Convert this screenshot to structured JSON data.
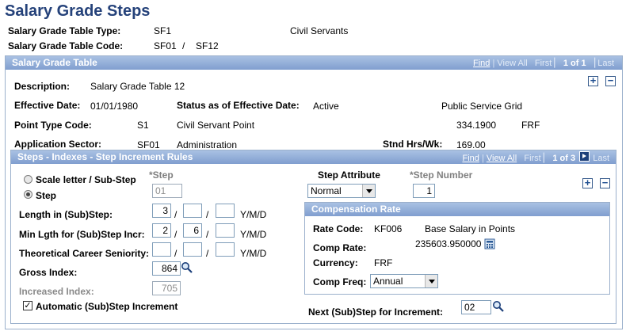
{
  "page_title": "Salary Grade Steps",
  "header": {
    "table_type_label": "Salary Grade Table Type:",
    "table_type_value": "SF1",
    "table_type_desc": "Civil Servants",
    "table_code_label": "Salary Grade Table Code:",
    "table_code_value1": "SF01",
    "table_code_sep": "/",
    "table_code_value2": "SF12"
  },
  "salary_grade_table": {
    "title": "Salary Grade Table",
    "nav": {
      "find": "Find",
      "sep": "|",
      "view_all": "View All",
      "first": "First",
      "count": "1 of 1",
      "last": "Last"
    },
    "description_label": "Description:",
    "description_value": "Salary Grade Table 12",
    "effective_date_label": "Effective Date:",
    "effective_date_value": "01/01/1980",
    "status_label": "Status as of Effective Date:",
    "status_value": "Active",
    "grid_value": "Public Service Grid",
    "point_type_label": "Point Type Code:",
    "point_type_code": "S1",
    "point_type_desc": "Civil Servant Point",
    "point_value": "334.1900",
    "point_currency": "FRF",
    "sector_label": "Application Sector:",
    "sector_code": "SF01",
    "sector_desc": "Administration",
    "std_hours_label": "Stnd Hrs/Wk:",
    "std_hours_value": "169.00",
    "add_symbol": "+",
    "remove_symbol": "−"
  },
  "steps": {
    "title": "Steps - Indexes - Step Increment Rules",
    "nav": {
      "find": "Find",
      "sep": "|",
      "view_all": "View All",
      "first": "First",
      "count": "1 of 3",
      "last": "Last"
    },
    "radio_scale_label": "Scale letter / Sub-Step",
    "radio_step_label": "Step",
    "step_col_label": "*Step",
    "step_value": "01",
    "step_attribute_label": "Step Attribute",
    "step_attribute_value": "Normal",
    "step_number_label": "*Step Number",
    "step_number_value": "1",
    "length_label": "Length in (Sub)Step:",
    "length_values": [
      "3",
      "",
      ""
    ],
    "min_length_label": "Min Lgth for (Sub)Step Incr:",
    "min_length_values": [
      "2",
      "6",
      ""
    ],
    "career_label": "Theoretical Career Seniority:",
    "career_values": [
      "",
      "",
      ""
    ],
    "date_sep": "/",
    "ymd_label": "Y/M/D",
    "gross_index_label": "Gross Index:",
    "gross_index_value": "864",
    "increased_index_label": "Increased Index:",
    "increased_index_value": "705",
    "auto_increment_label": "Automatic (Sub)Step Increment",
    "auto_increment_checked": "✓",
    "next_step_label": "Next (Sub)Step for Increment:",
    "next_step_value": "02"
  },
  "compensation": {
    "title": "Compensation Rate",
    "rate_code_label": "Rate Code:",
    "rate_code_value": "KF006",
    "rate_code_desc": "Base Salary in Points",
    "comp_rate_label": "Comp Rate:",
    "comp_rate_value": "235603.950000",
    "currency_label": "Currency:",
    "currency_value": "FRF",
    "comp_freq_label": "Comp Freq:",
    "comp_freq_value": "Annual"
  },
  "colors": {
    "title": "#25427a",
    "header_bar": "#8faed8",
    "border": "#9bb0cc"
  },
  "icons": {
    "lookup": "magnifier-icon",
    "calculator": "calculator-icon",
    "next": "arrow-right-icon"
  }
}
